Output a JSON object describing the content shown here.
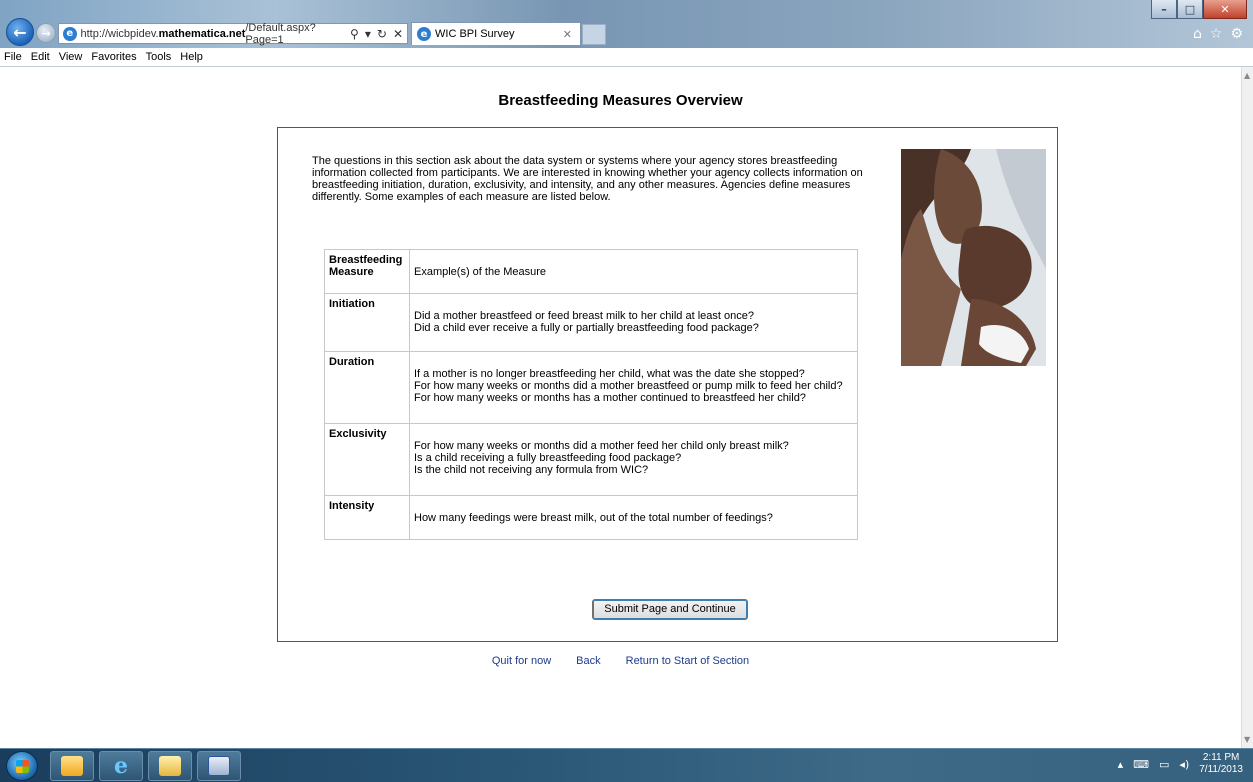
{
  "browser": {
    "url_prefix": "http://wicbpidev.",
    "url_domain": "mathematica.net",
    "url_suffix": "/Default.aspx?Page=1",
    "tab_title": "WIC BPI Survey",
    "menu": [
      "File",
      "Edit",
      "View",
      "Favorites",
      "Tools",
      "Help"
    ]
  },
  "page": {
    "title": "Breastfeeding Measures Overview",
    "intro": "The questions in this section ask about the data system or systems where your agency stores breastfeeding information collected from participants. We are interested in knowing whether your agency collects information on breastfeeding initiation, duration, exclusivity, and intensity, and any other measures. Agencies define measures differently. Some examples of each measure are listed below.",
    "table": {
      "header_measure": "Breastfeeding Measure",
      "header_examples": "Example(s) of the Measure",
      "rows": [
        {
          "measure": "Initiation",
          "examples": [
            "Did a mother breastfeed or feed breast milk to her child at least once?",
            "Did a child ever receive a fully or partially breastfeeding food package?"
          ]
        },
        {
          "measure": "Duration",
          "examples": [
            "If a mother is no longer breastfeeding her child, what was the date she stopped?",
            "For how many weeks or months did a mother breastfeed or pump milk to feed her child?",
            "For how many weeks or months has a mother continued to breastfeed her child?"
          ]
        },
        {
          "measure": "Exclusivity",
          "examples": [
            "For how many weeks or months did a mother feed her child only breast milk?",
            "Is a child receiving a fully breastfeeding food package?",
            "Is the child not receiving any formula from WIC?"
          ]
        },
        {
          "measure": "Intensity",
          "examples": [
            "How many feedings were breast milk, out of the total number of feedings?"
          ]
        }
      ]
    },
    "submit_label": "Submit Page and Continue",
    "links": {
      "quit": "Quit for now",
      "back": "Back",
      "return": "Return to Start of Section"
    }
  },
  "taskbar": {
    "time": "2:11 PM",
    "date": "7/11/2013"
  }
}
